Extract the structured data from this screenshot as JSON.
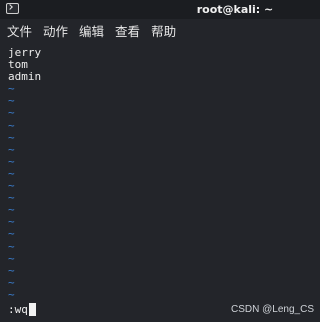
{
  "window": {
    "title": "root@kali: ~"
  },
  "menu": [
    {
      "label": "文件"
    },
    {
      "label": "动作"
    },
    {
      "label": "编辑"
    },
    {
      "label": "查看"
    },
    {
      "label": "帮助"
    }
  ],
  "editor": {
    "lines": [
      "jerry",
      "tom",
      "admin"
    ],
    "empty_line_marker": "~",
    "empty_line_count": 18
  },
  "command_line": {
    "text": ":wq"
  },
  "watermark": "CSDN @Leng_CS",
  "colors": {
    "background": "#23252a",
    "titlebar": "#1b1d21",
    "text": "#ededed",
    "tilde": "#3a7fd0"
  }
}
